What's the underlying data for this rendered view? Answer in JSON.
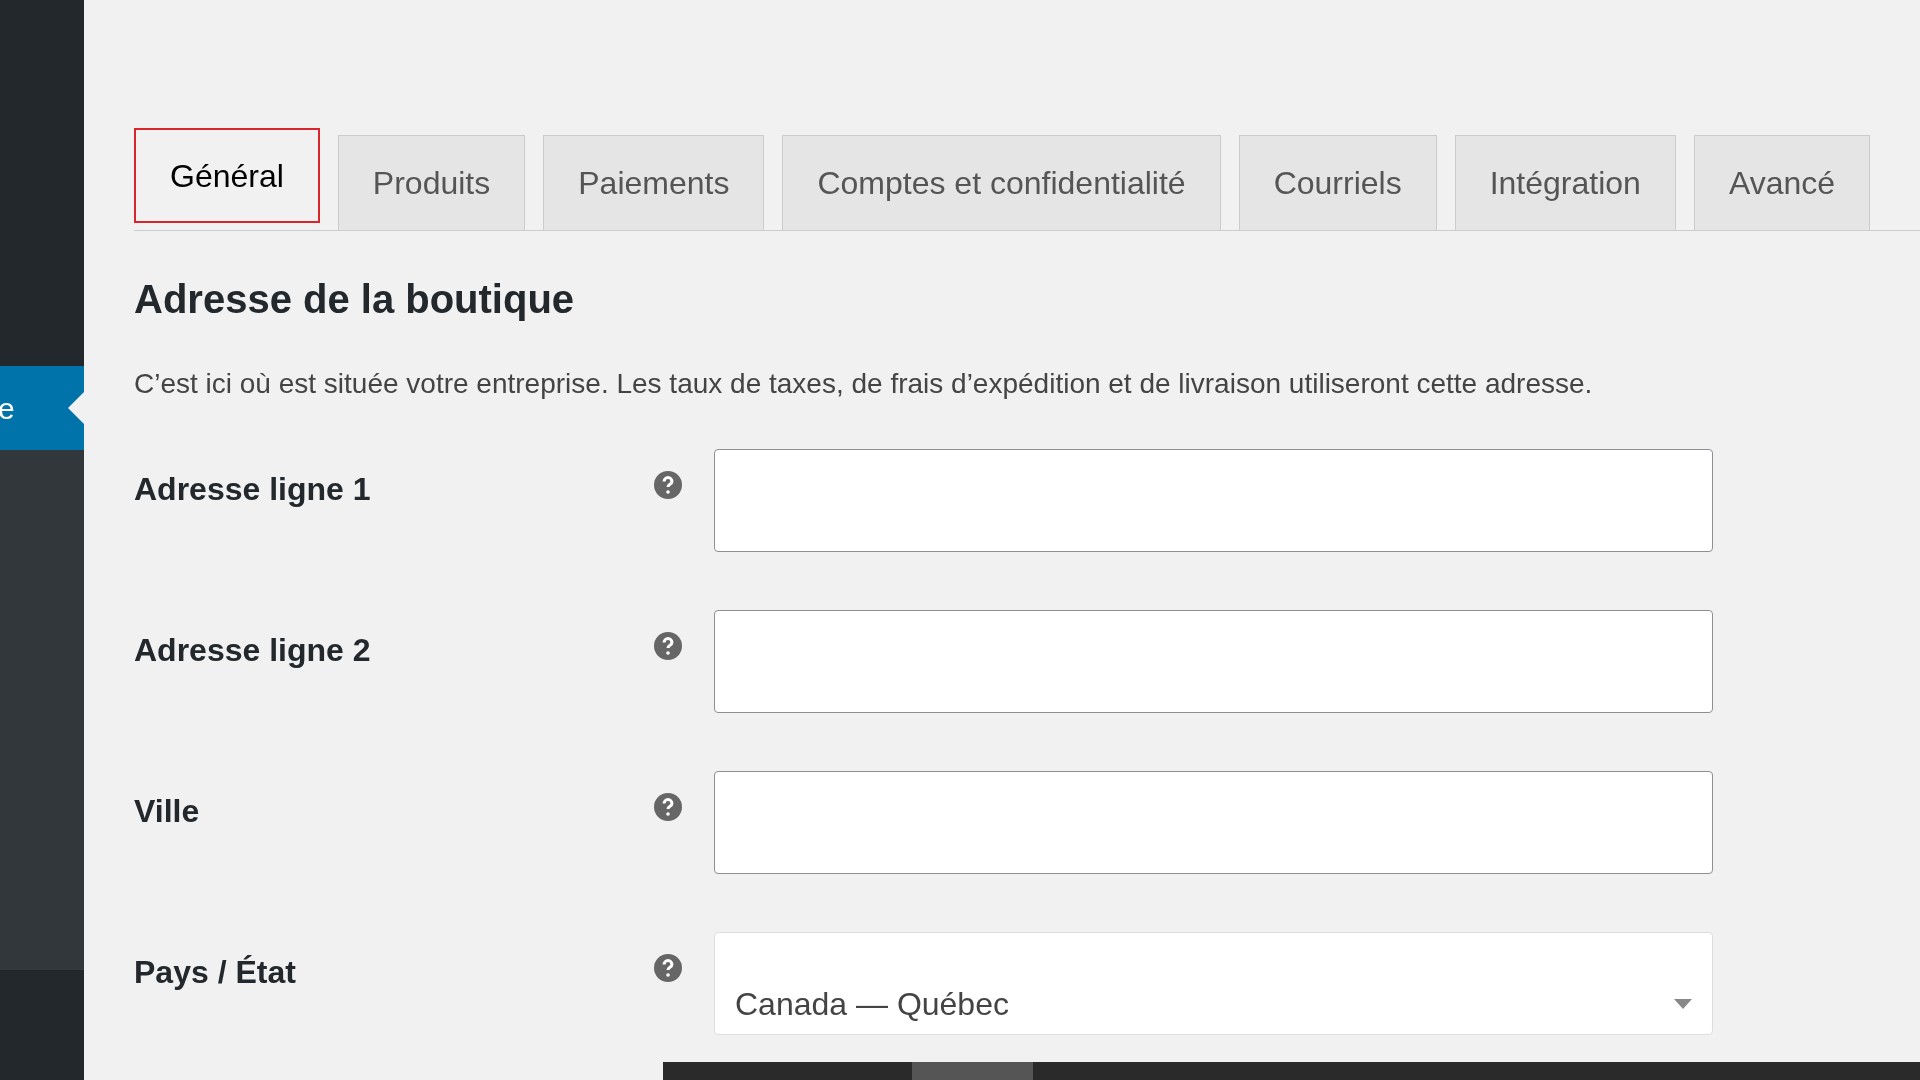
{
  "sidebar": {
    "items": [
      {
        "label": "e",
        "selected": true
      }
    ]
  },
  "tabs": [
    {
      "label": "Général",
      "selected": true
    },
    {
      "label": "Produits",
      "selected": false
    },
    {
      "label": "Paiements",
      "selected": false
    },
    {
      "label": "Comptes et confidentialité",
      "selected": false
    },
    {
      "label": "Courriels",
      "selected": false
    },
    {
      "label": "Intégration",
      "selected": false
    },
    {
      "label": "Avancé",
      "selected": false
    }
  ],
  "section": {
    "title": "Adresse de la boutique",
    "description": "C’est ici où est située votre entreprise. Les taux de taxes, de frais d’expédition et de livraison utiliseront cette adresse."
  },
  "fields": [
    {
      "label": "Adresse ligne 1",
      "kind": "text"
    },
    {
      "label": "Adresse ligne 2",
      "kind": "text"
    },
    {
      "label": "Ville",
      "kind": "text"
    },
    {
      "label": "Pays / État",
      "kind": "select",
      "value": "Canada — Québec"
    }
  ]
}
